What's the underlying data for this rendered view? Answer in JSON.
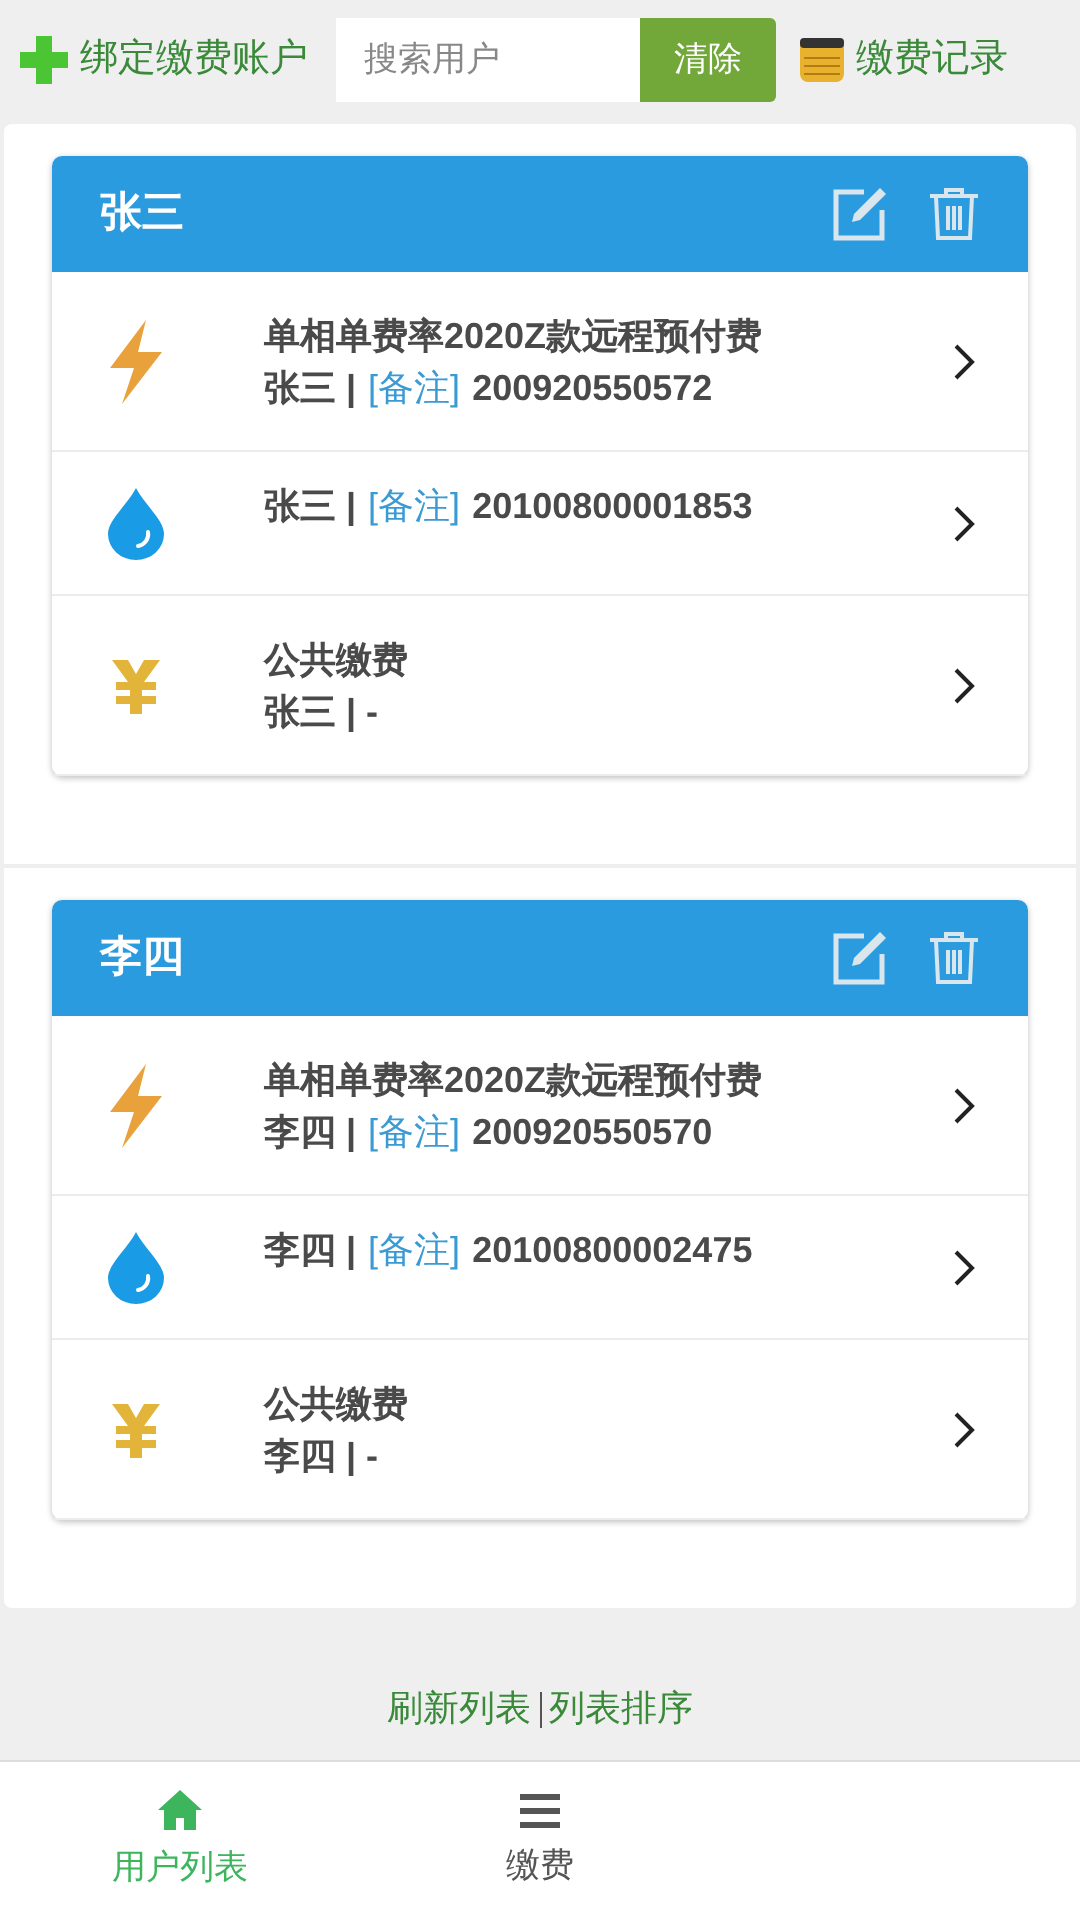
{
  "toolbar": {
    "bind_label": "绑定缴费账户",
    "search": {
      "placeholder": "搜索用户"
    },
    "clear_button": "清除",
    "records_label": "缴费记录"
  },
  "accounts": [
    {
      "name": "张三",
      "items": [
        {
          "kind": "electric",
          "title": "单相单费率2020Z款远程预付费",
          "owner": "张三 |",
          "note": "[备注]",
          "number": "200920550572"
        },
        {
          "kind": "water",
          "owner": "张三 |",
          "note": "[备注]",
          "number": "20100800001853"
        },
        {
          "kind": "public",
          "title": "公共缴费",
          "owner": "张三 | -"
        }
      ]
    },
    {
      "name": "李四",
      "items": [
        {
          "kind": "electric",
          "title": "单相单费率2020Z款远程预付费",
          "owner": "李四 |",
          "note": "[备注]",
          "number": "200920550570"
        },
        {
          "kind": "water",
          "owner": "李四 |",
          "note": "[备注]",
          "number": "20100800002475"
        },
        {
          "kind": "public",
          "title": "公共缴费",
          "owner": "李四 | -"
        }
      ]
    }
  ],
  "footer_links": [
    "刷新列表",
    "列表排序"
  ],
  "tabs": [
    {
      "label": "用户列表",
      "kind": "home",
      "selected": true
    },
    {
      "label": "缴费",
      "kind": "list",
      "selected": false
    }
  ]
}
